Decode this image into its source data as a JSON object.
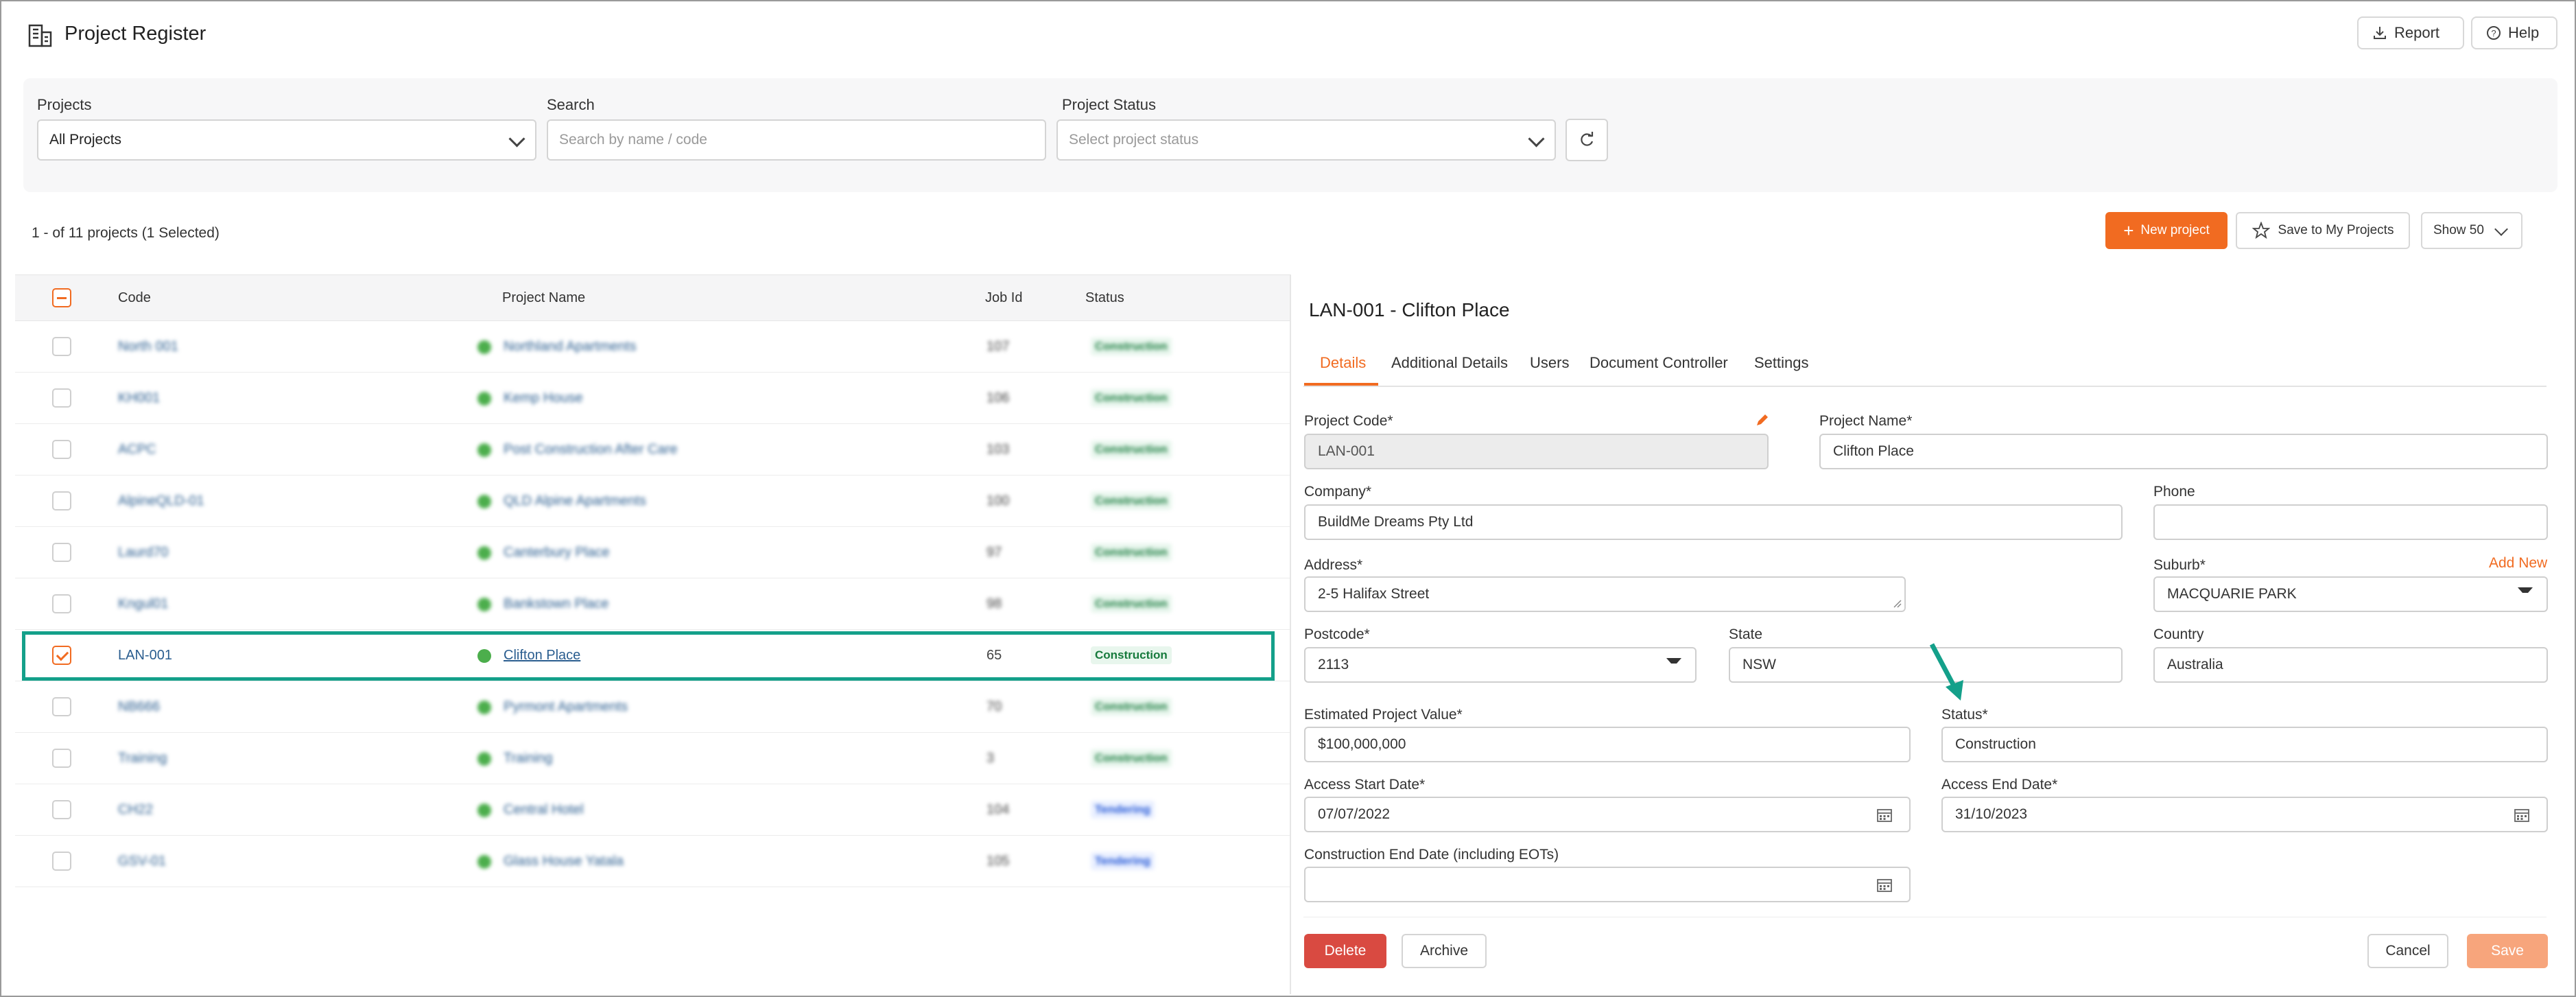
{
  "header": {
    "title": "Project Register",
    "report_label": "Report",
    "help_label": "Help"
  },
  "filters": {
    "projects_label": "Projects",
    "projects_value": "All Projects",
    "search_label": "Search",
    "search_placeholder": "Search by name / code",
    "status_label": "Project Status",
    "status_placeholder": "Select project status"
  },
  "toolbar": {
    "count_text": "1 - of 11 projects (1 Selected)",
    "new_project_label": "New project",
    "save_my_projects_label": "Save to My Projects",
    "show_label": "Show 50"
  },
  "table": {
    "columns": [
      "Code",
      "Project Name",
      "Job Id",
      "Status"
    ],
    "rows": [
      {
        "code": "North 001",
        "name": "Northland Apartments",
        "job_id": "107",
        "status": "Construction",
        "checked": false
      },
      {
        "code": "KH001",
        "name": "Kemp House",
        "job_id": "106",
        "status": "Construction",
        "checked": false
      },
      {
        "code": "ACPC",
        "name": "Post Construction After Care",
        "job_id": "103",
        "status": "Construction",
        "checked": false
      },
      {
        "code": "AlpineQLD-01",
        "name": "QLD Alpine Apartments",
        "job_id": "100",
        "status": "Construction",
        "checked": false
      },
      {
        "code": "Laurd70",
        "name": "Canterbury Place",
        "job_id": "97",
        "status": "Construction",
        "checked": false
      },
      {
        "code": "Kngul01",
        "name": "Bankstown Place",
        "job_id": "98",
        "status": "Construction",
        "checked": false
      },
      {
        "code": "LAN-001",
        "name": "Clifton Place",
        "job_id": "65",
        "status": "Construction",
        "checked": true
      },
      {
        "code": "NB666",
        "name": "Pyrmont Apartments",
        "job_id": "70",
        "status": "Construction",
        "checked": false
      },
      {
        "code": "Training",
        "name": "Training",
        "job_id": "3",
        "status": "Construction",
        "checked": false
      },
      {
        "code": "CH22",
        "name": "Central Hotel",
        "job_id": "104",
        "status": "Tendering",
        "checked": false
      },
      {
        "code": "GSV-01",
        "name": "Glass House Yatala",
        "job_id": "105",
        "status": "Tendering",
        "checked": false
      }
    ]
  },
  "detail": {
    "title": "LAN-001 - Clifton Place",
    "tabs": [
      "Details",
      "Additional Details",
      "Users",
      "Document Controller",
      "Settings"
    ],
    "fields": {
      "project_code_label": "Project Code*",
      "project_code": "LAN-001",
      "project_name_label": "Project Name*",
      "project_name": "Clifton Place",
      "company_label": "Company*",
      "company": "BuildMe Dreams Pty Ltd",
      "phone_label": "Phone",
      "phone": "",
      "address_label": "Address*",
      "address": "2-5 Halifax Street",
      "suburb_label": "Suburb*",
      "add_new_label": "Add New",
      "suburb": "MACQUARIE PARK",
      "postcode_label": "Postcode*",
      "postcode": "2113",
      "state_label": "State",
      "state": "NSW",
      "country_label": "Country",
      "country": "Australia",
      "est_value_label": "Estimated Project Value*",
      "est_value": "$100,000,000",
      "status_label": "Status*",
      "status": "Construction",
      "access_start_label": "Access Start Date*",
      "access_start": "07/07/2022",
      "access_end_label": "Access End Date*",
      "access_end": "31/10/2023",
      "construction_end_label": "Construction End Date (including EOTs)",
      "construction_end": ""
    },
    "buttons": {
      "delete": "Delete",
      "archive": "Archive",
      "cancel": "Cancel",
      "save": "Save"
    }
  },
  "colors": {
    "accent": "#f16b21",
    "highlight": "#14a08a",
    "danger": "#d94a41",
    "link": "#2a5d8f"
  }
}
